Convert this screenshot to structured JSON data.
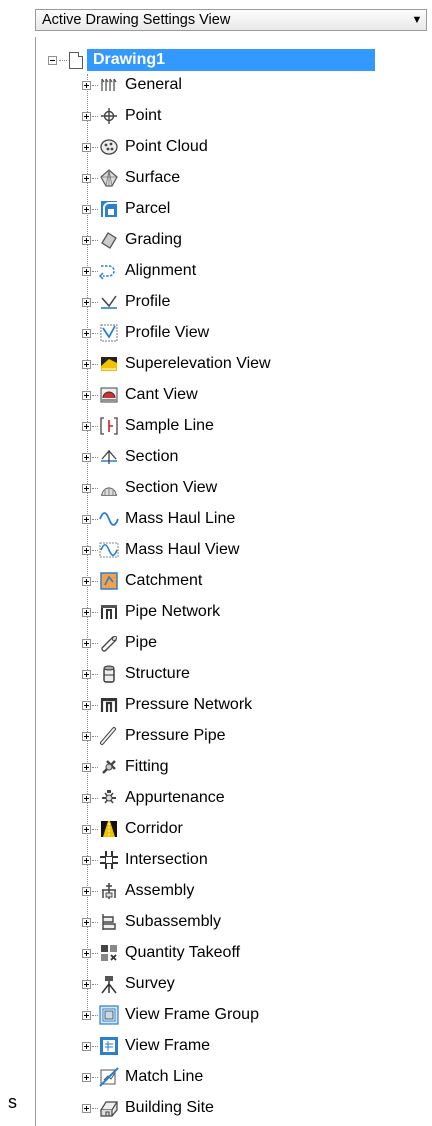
{
  "dropdown": {
    "value": "Active Drawing Settings View"
  },
  "tree": {
    "root": {
      "label": "Drawing1",
      "expanded": true,
      "selected": true,
      "icon": "document-icon"
    },
    "items": [
      {
        "label": "General",
        "icon": "general-icon"
      },
      {
        "label": "Point",
        "icon": "point-icon"
      },
      {
        "label": "Point Cloud",
        "icon": "point-cloud-icon"
      },
      {
        "label": "Surface",
        "icon": "surface-icon"
      },
      {
        "label": "Parcel",
        "icon": "parcel-icon"
      },
      {
        "label": "Grading",
        "icon": "grading-icon"
      },
      {
        "label": "Alignment",
        "icon": "alignment-icon"
      },
      {
        "label": "Profile",
        "icon": "profile-icon"
      },
      {
        "label": "Profile View",
        "icon": "profile-view-icon"
      },
      {
        "label": "Superelevation View",
        "icon": "superelevation-view-icon"
      },
      {
        "label": "Cant View",
        "icon": "cant-view-icon"
      },
      {
        "label": "Sample Line",
        "icon": "sample-line-icon"
      },
      {
        "label": "Section",
        "icon": "section-icon"
      },
      {
        "label": "Section View",
        "icon": "section-view-icon"
      },
      {
        "label": "Mass Haul Line",
        "icon": "mass-haul-line-icon"
      },
      {
        "label": "Mass Haul View",
        "icon": "mass-haul-view-icon"
      },
      {
        "label": "Catchment",
        "icon": "catchment-icon"
      },
      {
        "label": "Pipe Network",
        "icon": "pipe-network-icon"
      },
      {
        "label": "Pipe",
        "icon": "pipe-icon"
      },
      {
        "label": "Structure",
        "icon": "structure-icon"
      },
      {
        "label": "Pressure Network",
        "icon": "pressure-network-icon"
      },
      {
        "label": "Pressure Pipe",
        "icon": "pressure-pipe-icon"
      },
      {
        "label": "Fitting",
        "icon": "fitting-icon"
      },
      {
        "label": "Appurtenance",
        "icon": "appurtenance-icon"
      },
      {
        "label": "Corridor",
        "icon": "corridor-icon"
      },
      {
        "label": "Intersection",
        "icon": "intersection-icon"
      },
      {
        "label": "Assembly",
        "icon": "assembly-icon"
      },
      {
        "label": "Subassembly",
        "icon": "subassembly-icon"
      },
      {
        "label": "Quantity Takeoff",
        "icon": "quantity-takeoff-icon"
      },
      {
        "label": "Survey",
        "icon": "survey-icon"
      },
      {
        "label": "View Frame Group",
        "icon": "view-frame-group-icon"
      },
      {
        "label": "View Frame",
        "icon": "view-frame-icon"
      },
      {
        "label": "Match Line",
        "icon": "match-line-icon"
      },
      {
        "label": "Building Site",
        "icon": "building-site-icon"
      }
    ]
  },
  "side_text": "s"
}
